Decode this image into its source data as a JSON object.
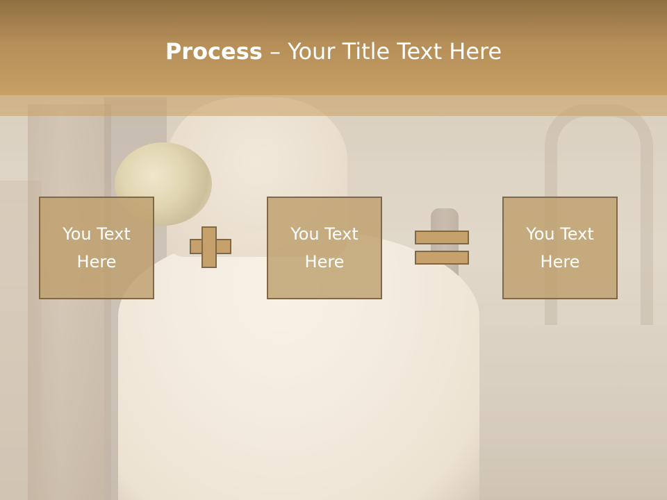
{
  "slide": {
    "title_bold": "Process",
    "title_rest": " – Your Title Text Here"
  },
  "process": {
    "boxes": [
      {
        "text": "You Text Here"
      },
      {
        "text": "You Text Here"
      },
      {
        "text": "You Text Here"
      }
    ],
    "operators": [
      "plus-icon",
      "equals-icon"
    ]
  },
  "colors": {
    "header": "#b58e58",
    "box_fill": "#c7a16c",
    "box_border": "#7e6848",
    "text": "#ffffff"
  }
}
